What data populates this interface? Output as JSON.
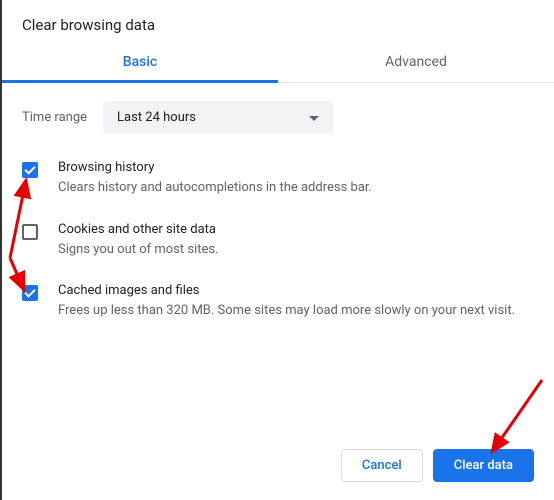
{
  "title": "Clear browsing data",
  "tabs": {
    "basic": "Basic",
    "advanced": "Advanced"
  },
  "time_range": {
    "label": "Time range",
    "value": "Last 24 hours"
  },
  "options": {
    "browsing_history": {
      "checked": true,
      "title": "Browsing history",
      "desc": "Clears history and autocompletions in the address bar."
    },
    "cookies": {
      "checked": false,
      "title": "Cookies and other site data",
      "desc": "Signs you out of most sites."
    },
    "cache": {
      "checked": true,
      "title": "Cached images and files",
      "desc": "Frees up less than 320 MB. Some sites may load more slowly on your next visit."
    }
  },
  "buttons": {
    "cancel": "Cancel",
    "clear": "Clear data"
  }
}
